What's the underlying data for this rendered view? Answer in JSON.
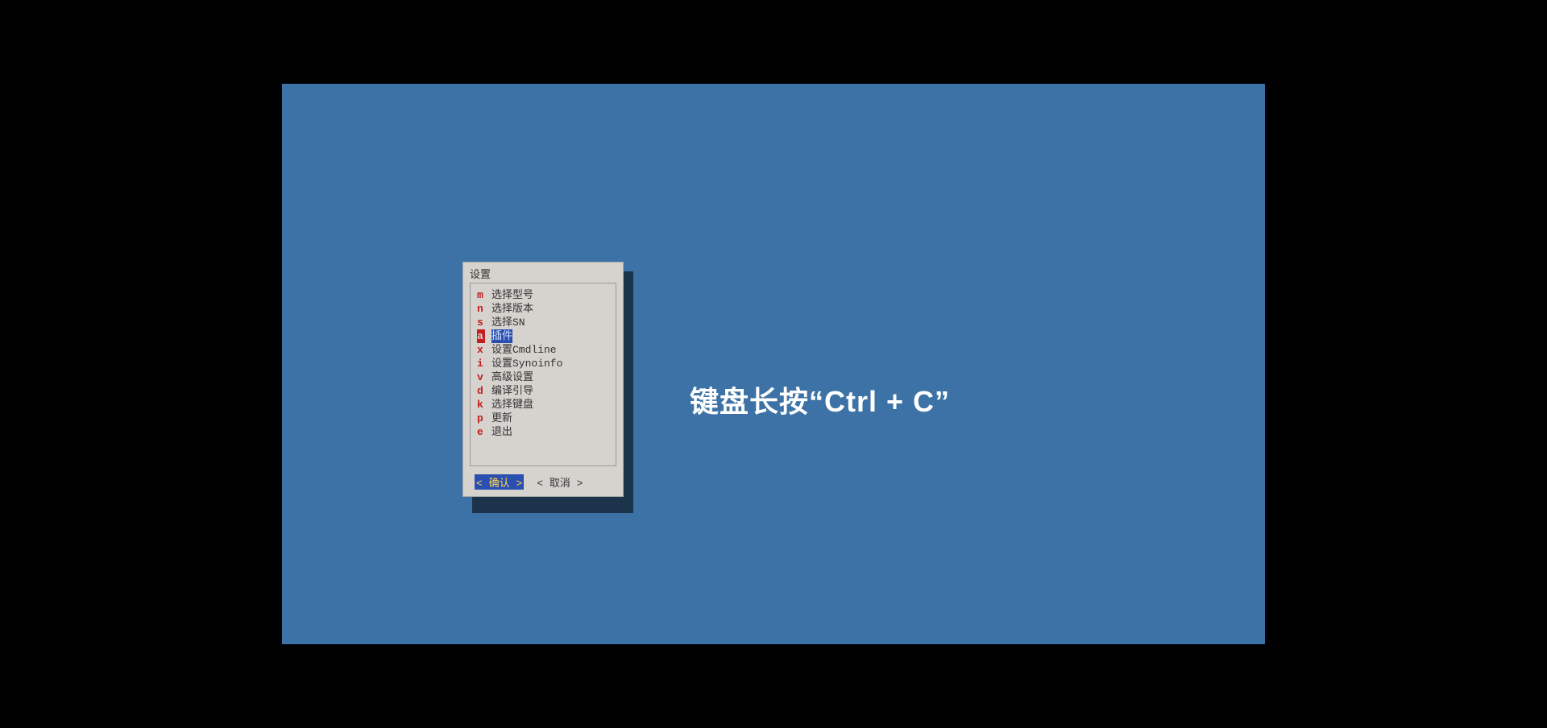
{
  "dialog": {
    "title": "设置",
    "items": [
      {
        "key": "m",
        "label": "选择型号",
        "selected": false
      },
      {
        "key": "n",
        "label": "选择版本",
        "selected": false
      },
      {
        "key": "s",
        "label": "选择SN",
        "selected": false
      },
      {
        "key": "a",
        "label": "插件",
        "selected": true
      },
      {
        "key": "x",
        "label": "设置Cmdline",
        "selected": false
      },
      {
        "key": "i",
        "label": "设置Synoinfo",
        "selected": false
      },
      {
        "key": "v",
        "label": "高级设置",
        "selected": false
      },
      {
        "key": "d",
        "label": "编译引导",
        "selected": false
      },
      {
        "key": "k",
        "label": "选择键盘",
        "selected": false
      },
      {
        "key": "p",
        "label": "更新",
        "selected": false
      },
      {
        "key": "e",
        "label": "退出",
        "selected": false
      }
    ],
    "ok_label": "< 确认 >",
    "cancel_label": "< 取消 >"
  },
  "hint": "键盘长按“Ctrl + C”"
}
